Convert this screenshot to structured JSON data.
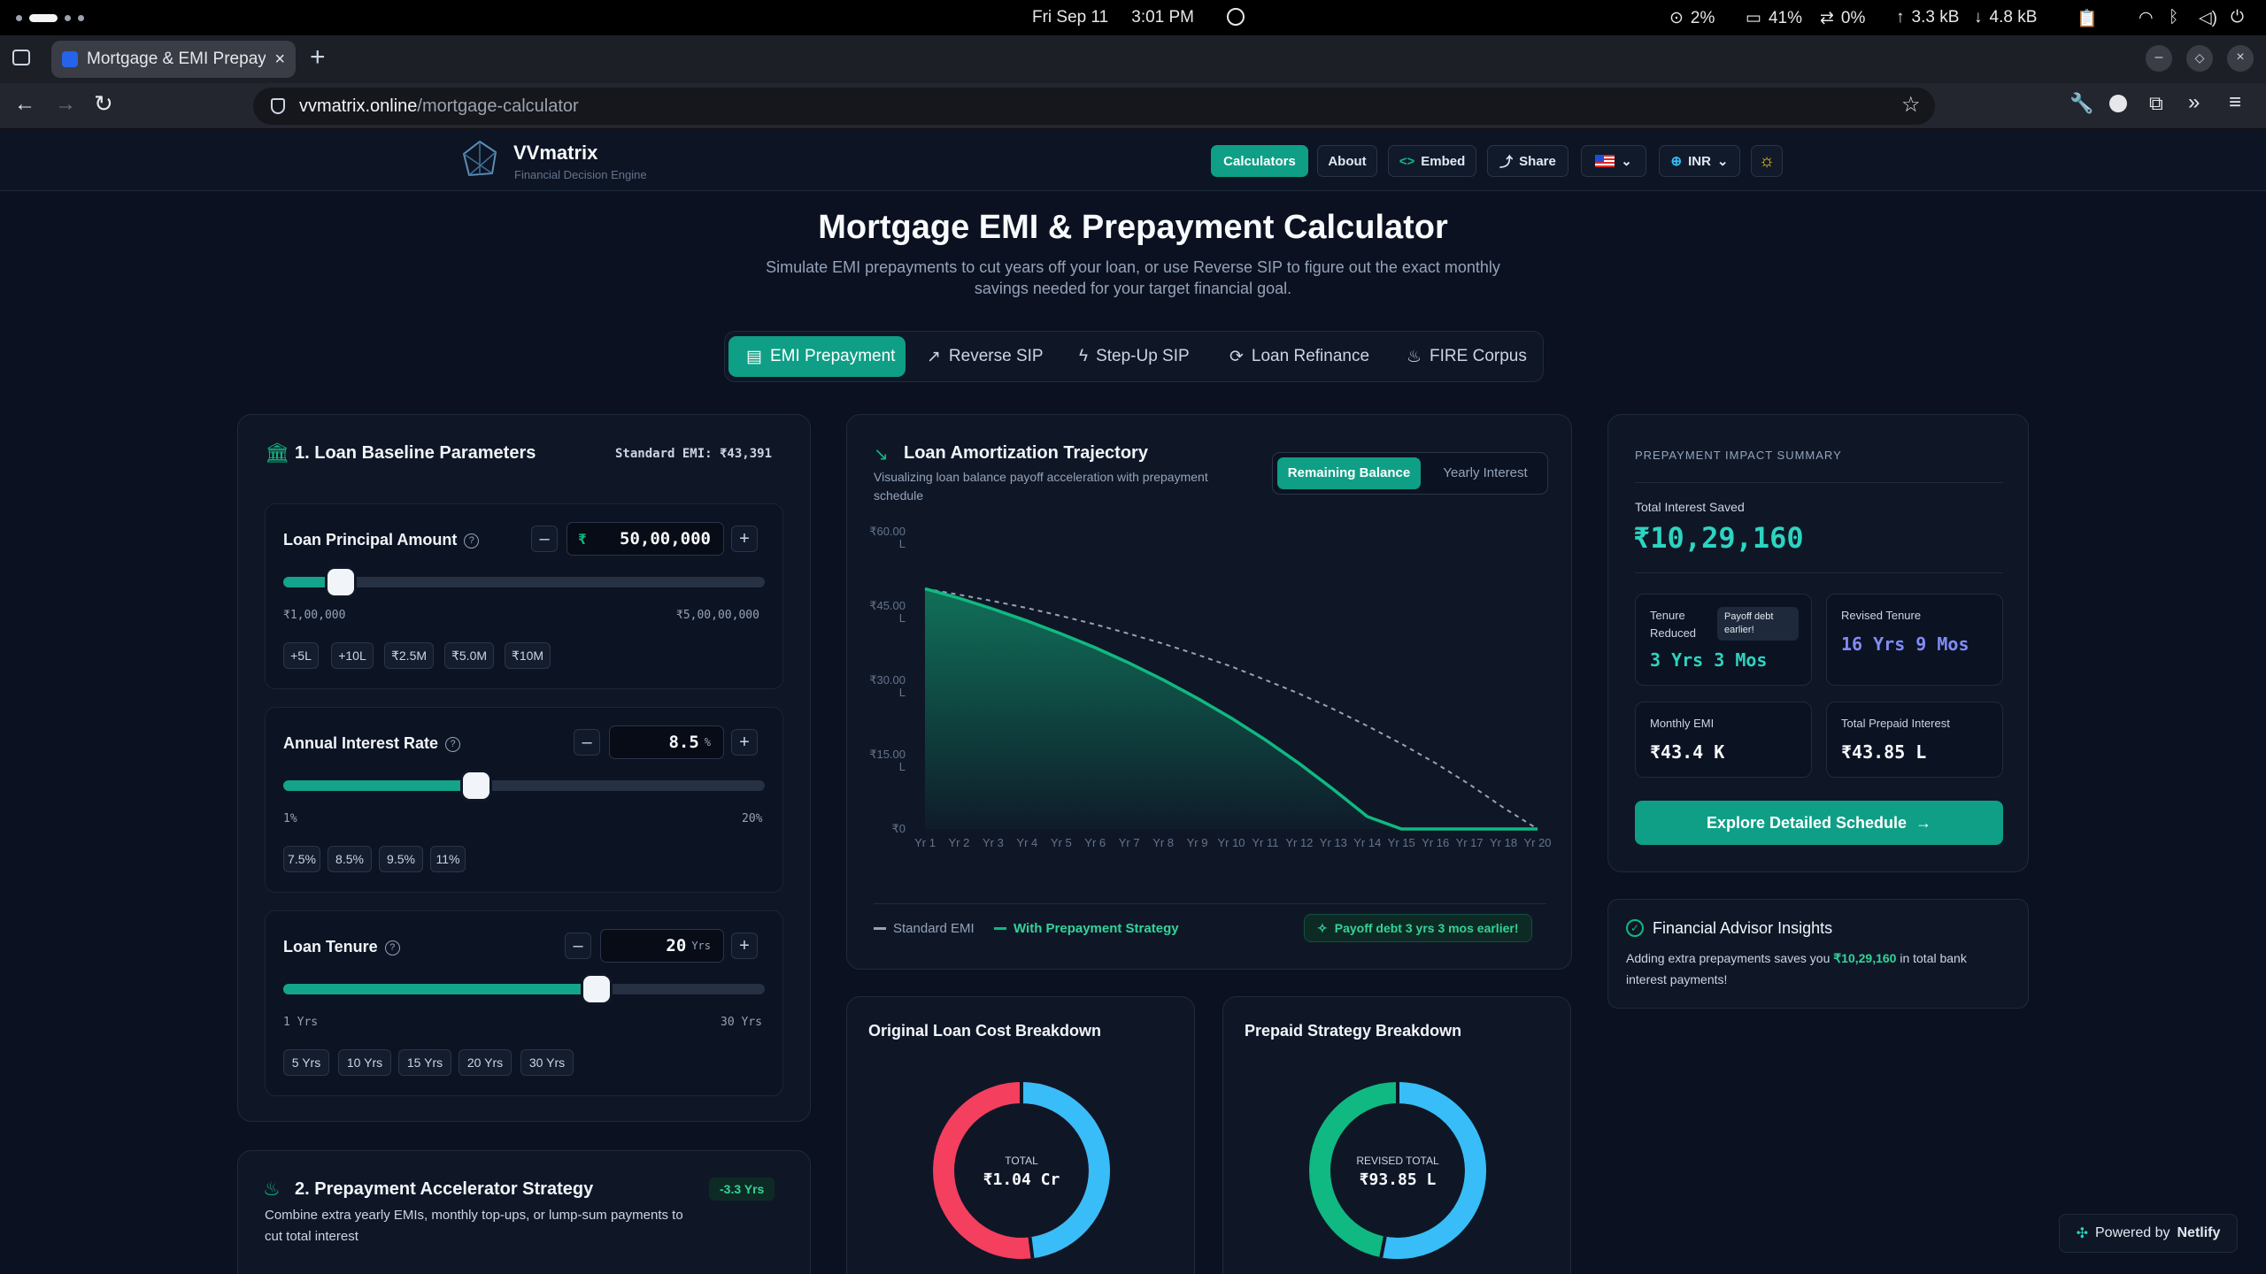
{
  "os": {
    "date": "Fri Sep 11",
    "time": "3:01 PM",
    "cpu": "2%",
    "mem": "41%",
    "swap": "0%",
    "up": "3.3 kB",
    "down": "4.8 kB"
  },
  "browser": {
    "tab_title": "Mortgage & EMI Prepaym",
    "url_domain": "vvmatrix.online",
    "url_path": "/mortgage-calculator"
  },
  "header": {
    "brand": "VVmatrix",
    "tagline": "Financial Decision Engine",
    "nav": {
      "calculators": "Calculators",
      "about": "About",
      "embed": "Embed",
      "share": "Share",
      "currency": "INR"
    }
  },
  "hero": {
    "title": "Mortgage EMI & Prepayment Calculator",
    "subtitle_1": "Simulate EMI prepayments to cut years off your loan, or use Reverse SIP to figure out the exact monthly",
    "subtitle_2": "savings needed for your target financial goal.",
    "tabs": [
      "EMI Prepayment",
      "Reverse SIP",
      "Step-Up SIP",
      "Loan Refinance",
      "FIRE Corpus"
    ]
  },
  "baseline": {
    "title": "1. Loan Baseline Parameters",
    "standard_emi": "Standard EMI: ₹43,391",
    "principal": {
      "label": "Loan Principal Amount",
      "prefix": "₹",
      "value": "50,00,000",
      "min": "₹1,00,000",
      "max": "₹5,00,00,000",
      "level": 0.12,
      "chips": [
        "+5L",
        "+10L",
        "₹2.5M",
        "₹5.0M",
        "₹10M"
      ]
    },
    "rate": {
      "label": "Annual Interest Rate",
      "value": "8.5",
      "unit": "%",
      "min": "1%",
      "max": "20%",
      "level": 0.4,
      "chips": [
        "7.5%",
        "8.5%",
        "9.5%",
        "11%"
      ]
    },
    "tenure": {
      "label": "Loan Tenure",
      "value": "20",
      "unit": "Yrs",
      "min": "1 Yrs",
      "max": "30 Yrs",
      "level": 0.65,
      "chips": [
        "5 Yrs",
        "10 Yrs",
        "15 Yrs",
        "20 Yrs",
        "30 Yrs"
      ]
    }
  },
  "prepay": {
    "title": "2. Prepayment Accelerator Strategy",
    "badge": "-3.3 Yrs",
    "desc_1": "Combine extra yearly EMIs, monthly top-ups, or lump-sum payments to",
    "desc_2": "cut total interest"
  },
  "amort": {
    "title": "Loan Amortization Trajectory",
    "desc_1": "Visualizing loan balance payoff acceleration with prepayment",
    "desc_2": "schedule",
    "toggle": [
      "Remaining Balance",
      "Yearly Interest"
    ],
    "legend_standard": "Standard EMI",
    "legend_prepay": "With Prepayment Strategy",
    "payoff_note": "Payoff debt 3 yrs 3 mos earlier!"
  },
  "chart_data": {
    "type": "area",
    "x": [
      "Yr 1",
      "Yr 2",
      "Yr 3",
      "Yr 4",
      "Yr 5",
      "Yr 6",
      "Yr 7",
      "Yr 8",
      "Yr 9",
      "Yr 10",
      "Yr 11",
      "Yr 12",
      "Yr 13",
      "Yr 14",
      "Yr 15",
      "Yr 16",
      "Yr 17",
      "Yr 18",
      "Yr 20"
    ],
    "yticks": [
      {
        "v": 60,
        "t": "₹60.00",
        "u": "L"
      },
      {
        "v": 45,
        "t": "₹45.00",
        "u": "L"
      },
      {
        "v": 30,
        "t": "₹30.00",
        "u": "L"
      },
      {
        "v": 15,
        "t": "₹15.00",
        "u": "L"
      },
      {
        "v": 0,
        "t": "₹0",
        "u": ""
      }
    ],
    "ylim": [
      0,
      60
    ],
    "series": [
      {
        "name": "Standard EMI",
        "style": "dashed",
        "values": [
          48.5,
          47.3,
          46.0,
          44.6,
          43.0,
          41.3,
          39.4,
          37.4,
          35.2,
          32.8,
          30.1,
          27.3,
          24.2,
          20.8,
          17.2,
          13.3,
          9.0,
          4.3,
          0
        ]
      },
      {
        "name": "With Prepayment Strategy",
        "style": "area",
        "values": [
          48.5,
          46.6,
          44.4,
          42.0,
          39.4,
          36.6,
          33.5,
          30.1,
          26.4,
          22.4,
          18.0,
          13.2,
          8.0,
          2.5,
          0,
          0,
          0,
          0,
          0
        ]
      }
    ]
  },
  "summary": {
    "heading": "PREPAYMENT IMPACT SUMMARY",
    "interest_label": "Total Interest Saved",
    "interest_value": "₹10,29,160",
    "tenure_reduced_label_1": "Tenure",
    "tenure_reduced_label_2": "Reduced",
    "tenure_badge_1": "Payoff debt",
    "tenure_badge_2": "earlier!",
    "tenure_reduced_value": "3 Yrs 3 Mos",
    "revised_label": "Revised Tenure",
    "revised_value": "16 Yrs 9 Mos",
    "emi_label": "Monthly EMI",
    "emi_value": "₹43.4 K",
    "prepaid_label": "Total Prepaid Interest",
    "prepaid_value": "₹43.85 L",
    "cta": "Explore Detailed Schedule"
  },
  "insights": {
    "title": "Financial Advisor Insights",
    "text_1": "Adding extra prepayments saves you ",
    "amount": "₹10,29,160",
    "text_2": " in total bank",
    "text_3": "interest payments!"
  },
  "breakdown_original": {
    "title": "Original Loan Cost Breakdown",
    "center_label": "TOTAL",
    "center_value": "₹1.04 Cr",
    "principal_share": 0.48,
    "colors": {
      "principal": "#38bdf8",
      "interest": "#f43f5e"
    }
  },
  "breakdown_prepaid": {
    "title": "Prepaid Strategy Breakdown",
    "center_label": "REVISED TOTAL",
    "center_value": "₹93.85 L",
    "principal_share": 0.53,
    "colors": {
      "principal": "#38bdf8",
      "interest": "#10b981"
    }
  },
  "footer": {
    "powered": "Powered by",
    "brand": "Netlify"
  }
}
